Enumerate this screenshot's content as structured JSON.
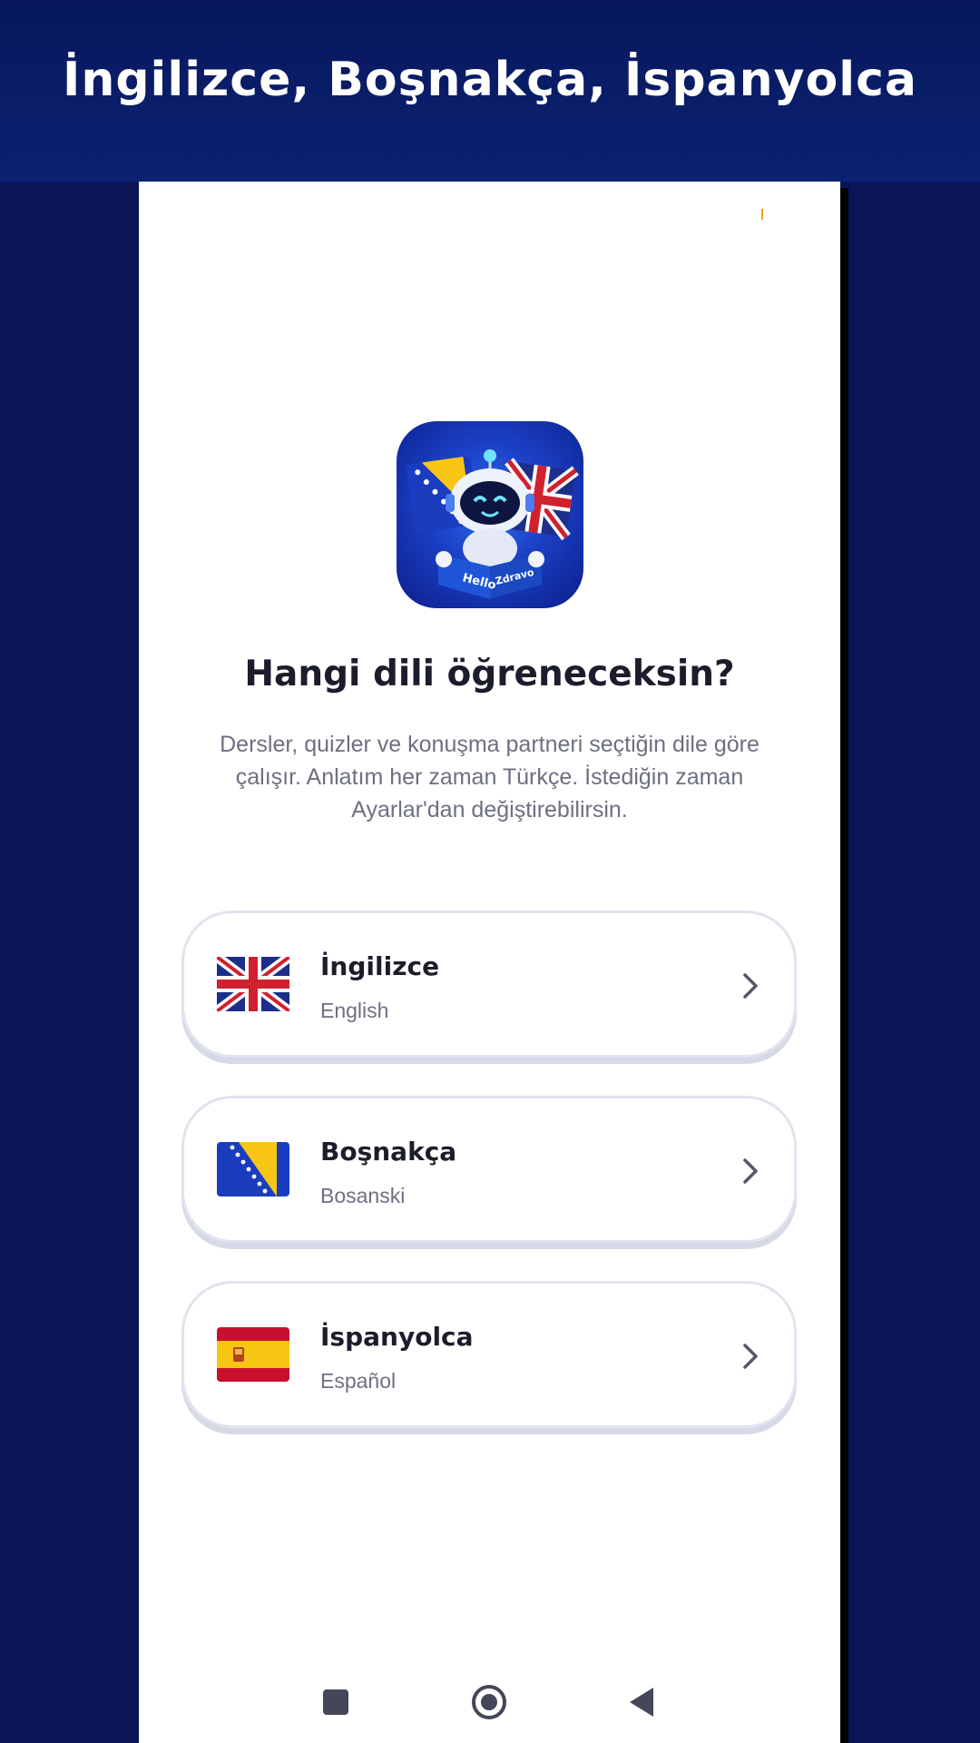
{
  "banner": {
    "title": "İngilizce, Boşnakça, İspanyolca"
  },
  "app": {
    "logo": {
      "icon": "robot-flags-logo",
      "book_left": "Hello",
      "book_right": "Zdravo"
    },
    "heading": "Hangi dili öğreneceksin?",
    "subtitle": "Dersler, quizler ve konuşma partneri seçtiğin dile göre çalışır. Anlatım her zaman Türkçe. İstediğin zaman Ayarlar'dan değiştirebilirsin.",
    "languages": [
      {
        "name": "İngilizce",
        "native": "English",
        "flag": "uk-flag-icon"
      },
      {
        "name": "Boşnakça",
        "native": "Bosanski",
        "flag": "bosnia-flag-icon"
      },
      {
        "name": "İspanyolca",
        "native": "Español",
        "flag": "spain-flag-icon"
      }
    ]
  },
  "navbar": {
    "icons": [
      "recents-square-icon",
      "home-circle-icon",
      "back-triangle-icon"
    ]
  },
  "colors": {
    "background": "#0a1456",
    "heading": "#1c1d2c",
    "muted": "#6d7080",
    "card_border": "#e1e3ee"
  }
}
